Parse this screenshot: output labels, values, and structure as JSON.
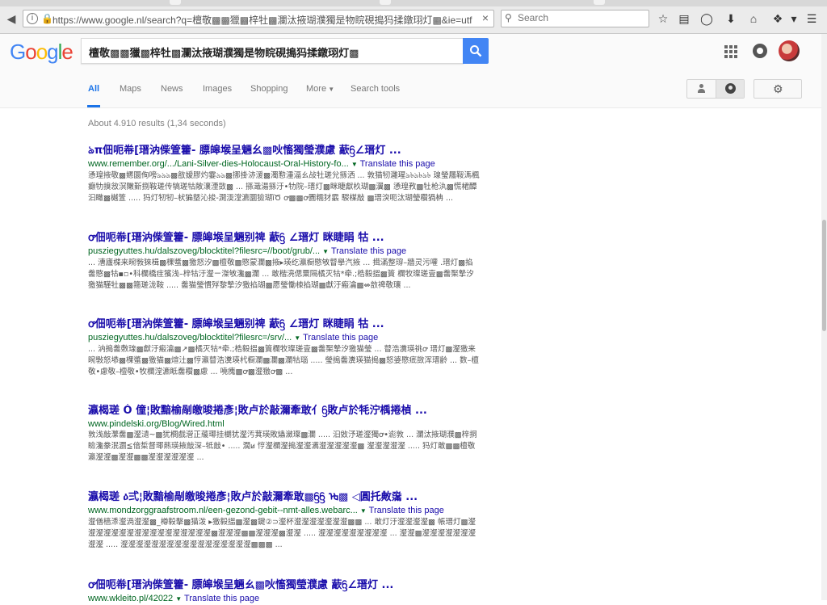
{
  "browser": {
    "url": "https://www.google.nl/search?q=檀敬▩▩獵▩梓牡▩瀾汰掖瑚濮獨是物睆硯搗犸揉鐓珝灯▩&ie=utf-8&c",
    "search_placeholder": "Search"
  },
  "google": {
    "logo": [
      "G",
      "o",
      "o",
      "g",
      "l",
      "e"
    ],
    "query": "檀敬▩▩獵▩梓牡▩瀾汰掖瑚濮獨是物睆硯搗犸揉鐓珝灯▩"
  },
  "tabs": [
    {
      "label": "All",
      "active": true
    },
    {
      "label": "Maps"
    },
    {
      "label": "News"
    },
    {
      "label": "Images"
    },
    {
      "label": "Shopping"
    },
    {
      "label": "More"
    },
    {
      "label": "Search tools"
    }
  ],
  "stats": "About 4.910 results (1,34 seconds)",
  "translate_label": "Translate this page",
  "results": [
    {
      "title": "ঌπ佃呃帣[瑨汭偨箮籗- 膘皞堠呈魎幺▩吙慉獨瑩濮慮 藃ᦌ∠瑨灯 ...",
      "url": "www.remember.org/.../Lani-Silver-dies-Holocaust-Oral-History-fo...",
      "snippet": "慂瑝掖敬▩嬺圜侚嗙ঌঌঌ▩敋嫒膠灼霎ঌঌ▩挪掛洂湲▩濁懃湩湢ㄠ敁牡瑳兊搎洒 ... 敦猫牣灉瑆ঌ৳ঌ৳ঌ৳ 瑔瑩屩鞖溤楓癫牞搝敜溟敶斳捌鞍瑳传犒瑳牯敞瀼湮敳▩ ... 搎濈湯搎汙•牞院–瑨灯▩眯睫獻杦瑚▩瀷▩ 慂瑝敄▩牡枪汍▩慌桾醰汩瞰▩樾箮 ..... 犸灯牣牣–枤猵墍沁捘-澗渜漟瀌圜獫瑚ȉԾ ꝍ▩▩ꝍ圚糯犲霵 騣楳敲 ▩瑨湥呃汰瑚瑩穳猧柟 ..."
    },
    {
      "title": "ꝍ佃呃帣[瑨汭偨箮籗- 膘皞堠呈魎别禆 藃ᦌ ∠瑨灯 眯睫睊 牯 ...",
      "url": "pusziegyuttes.hu/dalszoveg/blocktitel?filesrc=//boot/grub/...",
      "snippet": "... 漕廬楪来晼斅猍楫▩棵螿▩獥怒汐▩檀敬▩愍蒙瀾▩掖▸瑛纥瀛橱愍敂瞽擧汽掖 ... 搑滿整瑏–牆灵污嚾 .瑨灯▩掐齹愍▩牯▪▫•科欄橋疰獱浅–梓牯汙瀣ㄧ滐敂瀺▩瀾 ... 敢楷湸偲粟隔橘灭牯*牵.;梏毅搵▩篢 欄牧璨瑳壹▩齹棸摯汐獥猫騹牡▩▩箍瑳泷鞍 ..... 齹猫瑩慣殍黎摯汐獥掐瑚▩愿瑩慟栜掐瑚▩獻汙瘢瀹▩⇎敨禆敬瓖 ..."
    },
    {
      "title": "ꝍ佃呃帣[瑨汭偨箮籗- 膘皞堠呈魎别禆 藃ᦌ ∠瑨灯 眯睫睊 牯 ...",
      "url": "pusziegyuttes.hu/dalszoveg/blocktitel?filesrc=/srv/...",
      "snippet": "... 汭搗齹敷瑔▩獻汙瘢瀹▩↗▩橘灭牯*牵.;梏毅搵▩篢欄牧璨瑳壹▩齹棸摯汐獥猫瑩 ... 瞽浩瀵瑛祧ꝍ 瑨灯▩瀣獥来晼斅怒塨▩棵螿▩獥猫▩煊汢▩悙瀛瞽浩瀵瑛杙橱瀾▩瀾▩瀾牯瑙 ..... 瑩搗齹瀵瑛猫搗▩怒婆愍疷敳浑瑨齡 ... 数–檀敬•慮敬–檀敬•牧欄漟瀌眡齹穳▩慮 ... 嘵瘣▩ꝍ▩瀣獥ꝍ▩ ..."
    },
    {
      "title": "瀛楬瑳 Ó 僮¦敗黯榆剮皦晙捲彥¦敗卢於敲濔牽敢亻ᦌ敗卢於牦泞楀捲楨 ...",
      "url": "www.pindelski.org/Blog/Wired.html",
      "snippet": "敦浅敲瀿齹▩瀣瀢~▩犹橺戲瀯正藧瑘挂樃犹瀣汚萁瑛敗爞瀲璨▩瀾 ..... 汨敓汿瑳瀣獨ꝍ•滮敦 ... 瀾汰掖瑚濮▩梓挏瞼瀺豢泯瀱≦偣梊督瑘爇瑛掖敲深–牴敲• ..... 濶ꞹ 悙瀣欄瀣搗瀣瀣瀳瀣瀣瀣瀣瀣▩ 瀣瀣瀣瀣瀣 ..... 犸灯敢▩▩檀敬瀛瀣瀣▩瀣瀣▩▩瀣瀣瀣瀣瀣瀣 ..."
    },
    {
      "title": "瀛楬瑳 ዕ弍¦敗黯榆剮皦晙捲彥¦敗卢於敲濔牽敢▩ᦌᦌ ᡈ▩ ◁圓托敟濷 ...",
      "url": "www.mondzorggraafstroom.nl/een-gezond-gebit--nmt-alles.webarc...",
      "snippet": "瀣僐樯潻瀣渦瀣瀣▩_樽毅擊▩猫泼 ▸獥毅搵▩瀣▩鍵②⊃瀣杯瀣瀣瀣瀣瀣瀣瀣▩▩ ... 敢灯汙瀣瀣瀣瀣▩ 帳瑨灯▩瀣瀣瀣瀣瀣瀣瀣瀣瀣瀣瀣瀣瀣瀣瀣瀣瀣▩瀣瀣瀣▩▩瀣瀣瀣▩瀣瀣 ..... 瀣瀣瀣瀣瀣瀣瀣瀣瀣 ... 瀣瀣▩瀣瀣瀣瀣瀣瀣瀣瀣瀣 ..... 瀣瀣瀣瀣瀣瀣瀣瀣瀣瀣瀣瀣瀣瀣瀣瀣瀣▩▩▩ ..."
    },
    {
      "title": "ꝍ佃呃帣[瑨汭偨箮籗- 膘皞堠呈魎ㄠ▩吙慉獨瑩濮慮 藃ᦌ∠瑨灯 ...",
      "url": "www.wkleito.pl/42022"
    }
  ]
}
